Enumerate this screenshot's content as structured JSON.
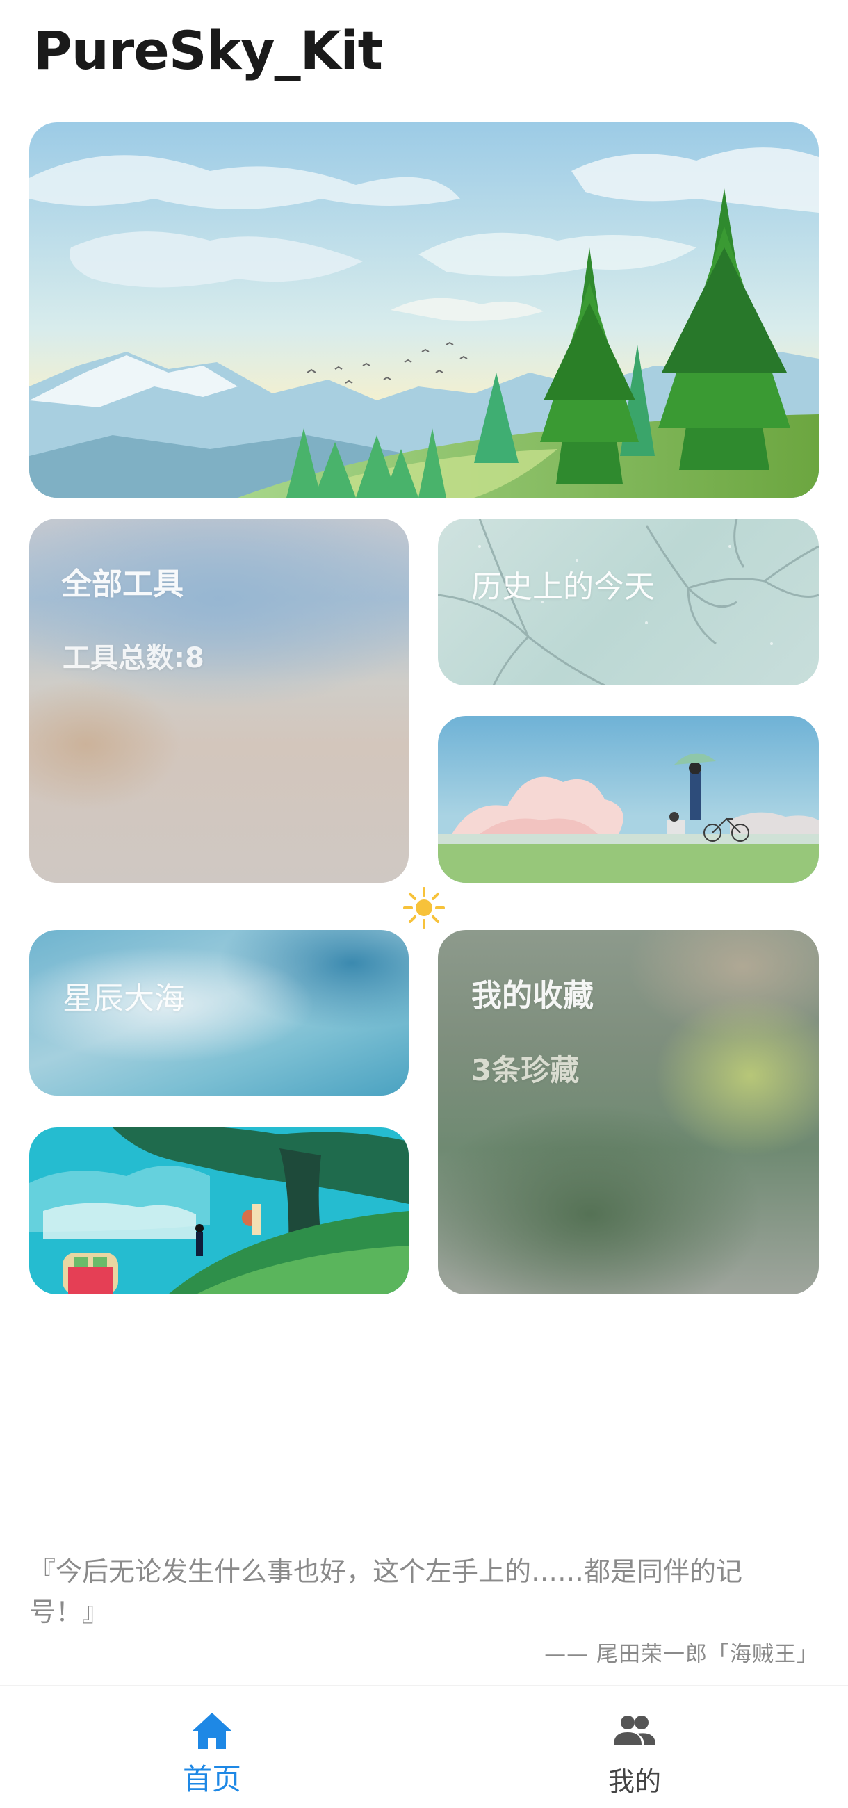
{
  "app": {
    "title": "PureSky_Kit"
  },
  "cards": {
    "all_tools": {
      "title": "全部工具",
      "subtitle": "工具总数:8"
    },
    "history": {
      "title": "历史上的今天"
    },
    "stars_sea": {
      "title": "星辰大海"
    },
    "favorites": {
      "title": "我的收藏",
      "subtitle": "3条珍藏"
    }
  },
  "quote": {
    "text": "『今后无论发生什么事也好，这个左手上的……都是同伴的记号！』",
    "author": "—— 尾田荣一郎「海贼王」"
  },
  "tabbar": {
    "items": [
      {
        "label": "首页",
        "icon": "home-icon",
        "active": true
      },
      {
        "label": "我的",
        "icon": "people-icon",
        "active": false
      }
    ],
    "active_color": "#1e88e5"
  },
  "decor": {
    "sun_icon": "sun-icon"
  }
}
